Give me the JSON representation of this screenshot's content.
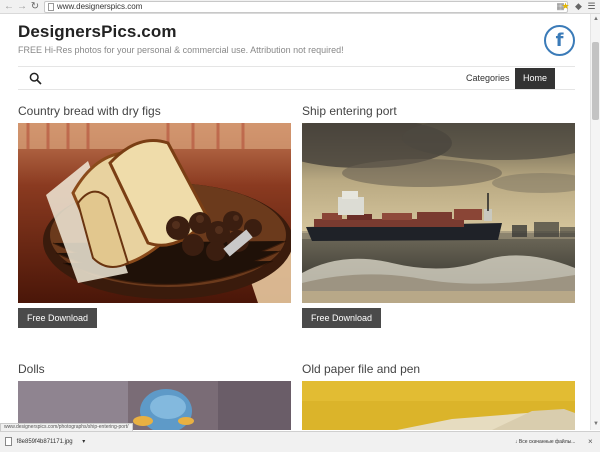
{
  "browser": {
    "back_icon": "back-arrow-icon",
    "forward_icon": "forward-arrow-icon",
    "reload_icon": "reload-icon",
    "url": "www.designerspics.com"
  },
  "site": {
    "title": "DesignersPics.com",
    "tagline": "FREE Hi-Res photos for your personal & commercial use. Attribution not required!",
    "facebook_label": "f",
    "facebook_color": "#3b7bb8"
  },
  "nav": {
    "search_icon": "search-icon",
    "categories_label": "Categories",
    "home_label": "Home"
  },
  "cards": [
    {
      "title": "Country bread with dry figs",
      "button": "Free Download"
    },
    {
      "title": "Ship entering port",
      "button": "Free Download"
    },
    {
      "title": "Dolls"
    },
    {
      "title": "Old paper file and pen"
    }
  ],
  "status": {
    "hover_url": "www.designerspics.com/photographs/ship-entering-port/"
  },
  "downloads": {
    "file_name": "f8e859f4b871171.jpg",
    "show_all_label": "Все скачанные файлы...",
    "close_label": "×"
  }
}
